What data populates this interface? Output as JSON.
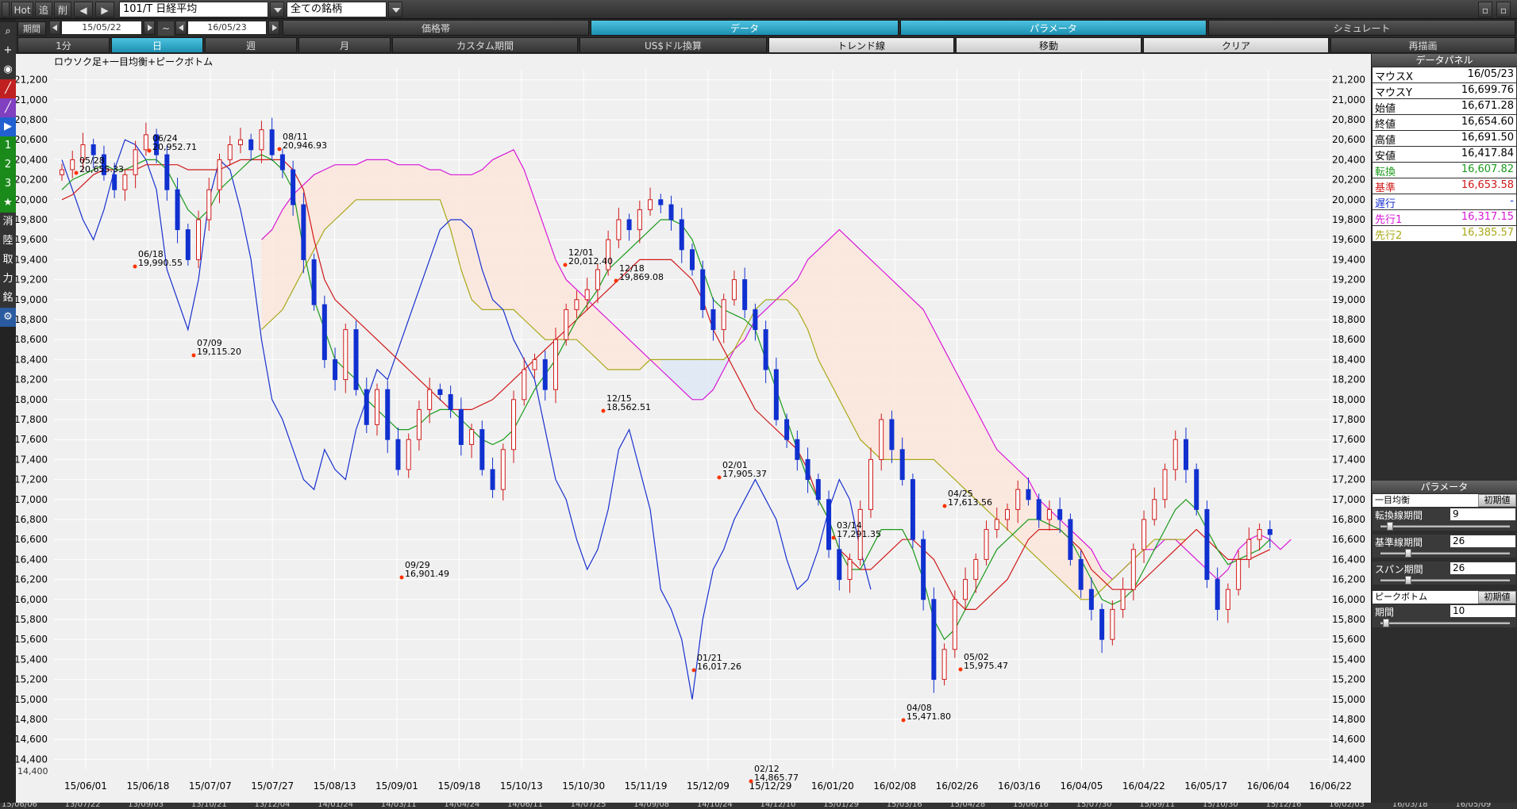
{
  "toolbar": {
    "hot": "Hot",
    "add": "追",
    "del": "削",
    "symbol": "101/T 日経平均",
    "filter": "全ての銘柄"
  },
  "period": {
    "label": "期間",
    "from": "15/05/22",
    "sep": "~",
    "to": "16/05/23"
  },
  "tabs_top": [
    "価格帯",
    "データ",
    "パラメータ",
    "シミュレート"
  ],
  "tabs_row3": [
    "1分",
    "日",
    "週",
    "月",
    "カスタム期間",
    "US$ドル換算",
    "トレンド線",
    "移動",
    "クリア",
    "再描画"
  ],
  "left_icons": [
    "⌕",
    "+",
    "◉",
    "╱",
    "╱",
    "▶",
    "1",
    "2",
    "3",
    "★",
    "消",
    "陸",
    "取",
    "力",
    "銘",
    "⚙"
  ],
  "chart": {
    "title": "ロウソク足+一目均衡+ピークボトム",
    "yticks": [
      "21,200",
      "21,000",
      "20,800",
      "20,600",
      "20,400",
      "20,200",
      "20,000",
      "19,800",
      "19,600",
      "19,400",
      "19,200",
      "19,000",
      "18,800",
      "18,600",
      "18,400",
      "18,200",
      "18,000",
      "17,800",
      "17,600",
      "17,400",
      "17,200",
      "17,000",
      "16,800",
      "16,600",
      "16,400",
      "16,200",
      "16,000",
      "15,800",
      "15,600",
      "15,400",
      "15,200",
      "15,000",
      "14,800",
      "14,600",
      "14,400"
    ],
    "xticks": [
      "15/06/01",
      "15/06/18",
      "15/07/07",
      "15/07/27",
      "15/08/13",
      "15/09/01",
      "15/09/18",
      "15/10/13",
      "15/10/30",
      "15/11/19",
      "15/12/09",
      "15/12/29",
      "16/01/20",
      "16/02/08",
      "16/02/26",
      "16/03/16",
      "16/04/05",
      "16/04/22",
      "16/05/17",
      "16/06/04",
      "16/06/22"
    ],
    "peaks": [
      {
        "date": "05/28",
        "value": "20,655.33"
      },
      {
        "date": "06/24",
        "value": "20,952.71"
      },
      {
        "date": "06/18",
        "value": "19,990.55"
      },
      {
        "date": "07/09",
        "value": "19,115.20"
      },
      {
        "date": "08/11",
        "value": "20,946.93"
      },
      {
        "date": "09/29",
        "value": "16,901.49"
      },
      {
        "date": "12/01",
        "value": "20,012.40"
      },
      {
        "date": "12/18",
        "value": "19,869.08"
      },
      {
        "date": "12/15",
        "value": "18,562.51"
      },
      {
        "date": "02/01",
        "value": "17,905.37"
      },
      {
        "date": "01/21",
        "value": "16,017.26"
      },
      {
        "date": "02/12",
        "value": "14,865.77"
      },
      {
        "date": "03/14",
        "value": "17,291.35"
      },
      {
        "date": "04/08",
        "value": "15,471.80"
      },
      {
        "date": "04/25",
        "value": "17,613.56"
      },
      {
        "date": "05/02",
        "value": "15,975.47"
      }
    ],
    "mini": "14,400"
  },
  "chart_data": {
    "type": "candlestick",
    "title": "ロウソク足+一目均衡+ピークボトム",
    "ylim": [
      14300,
      21300
    ],
    "series": [
      {
        "name": "candle_close",
        "values": [
          20300,
          20400,
          20550,
          20450,
          20250,
          20100,
          20250,
          20500,
          20650,
          20450,
          20100,
          19700,
          19400,
          19800,
          20100,
          20400,
          20550,
          20600,
          20500,
          20700,
          20450,
          20300,
          19950,
          19400,
          18950,
          18400,
          18200,
          18700,
          18100,
          17750,
          18100,
          17600,
          17300,
          17600,
          17900,
          18100,
          18050,
          17900,
          17550,
          17700,
          17300,
          17100,
          17500,
          18000,
          18300,
          18400,
          18100,
          18600,
          18900,
          19000,
          19100,
          19300,
          19600,
          19800,
          19700,
          19900,
          20000,
          19950,
          19800,
          19500,
          19300,
          18900,
          18700,
          19000,
          19200,
          18900,
          18700,
          18300,
          17800,
          17600,
          17400,
          17200,
          17000,
          16500,
          16200,
          16400,
          16900,
          17400,
          17800,
          17500,
          17200,
          16600,
          16000,
          15200,
          15500,
          16000,
          16200,
          16400,
          16700,
          16800,
          16900,
          17100,
          17000,
          16800,
          16900,
          16800,
          16400,
          16100,
          15900,
          15600,
          15900,
          16100,
          16500,
          16800,
          17000,
          17300,
          17600,
          17300,
          16900,
          16200,
          15900,
          16100,
          16400,
          16600,
          16700,
          16650
        ]
      },
      {
        "name": "転換線",
        "values": [
          20100,
          20200,
          20250,
          20300,
          20350,
          20300,
          20300,
          20350,
          20400,
          20400,
          20300,
          20100,
          19900,
          19800,
          19900,
          20100,
          20200,
          20300,
          20400,
          20450,
          20400,
          20300,
          20100,
          19500,
          19000,
          18700,
          18400,
          18300,
          18200,
          18000,
          17900,
          17800,
          17700,
          17700,
          17750,
          17850,
          17900,
          17900,
          17800,
          17700,
          17600,
          17550,
          17600,
          17700,
          17900,
          18100,
          18250,
          18400,
          18600,
          18800,
          18950,
          19100,
          19300,
          19400,
          19500,
          19600,
          19700,
          19800,
          19800,
          19750,
          19600,
          19300,
          19000,
          18900,
          18850,
          18800,
          18700,
          18400,
          18100,
          17800,
          17500,
          17200,
          17000,
          16800,
          16500,
          16300,
          16300,
          16500,
          16700,
          16700,
          16700,
          16500,
          16200,
          15800,
          15600,
          15700,
          15900,
          16100,
          16300,
          16500,
          16600,
          16700,
          16800,
          16800,
          16750,
          16700,
          16600,
          16400,
          16200,
          16000,
          15950,
          16000,
          16100,
          16300,
          16500,
          16700,
          16900,
          17000,
          16900,
          16700,
          16500,
          16350,
          16400,
          16450,
          16500,
          16600
        ]
      },
      {
        "name": "基準線",
        "values": [
          20000,
          20050,
          20150,
          20250,
          20300,
          20300,
          20300,
          20300,
          20350,
          20350,
          20350,
          20350,
          20300,
          20300,
          20300,
          20300,
          20350,
          20400,
          20400,
          20400,
          20400,
          20400,
          20300,
          20100,
          19600,
          19200,
          19000,
          18900,
          18800,
          18700,
          18600,
          18500,
          18400,
          18300,
          18200,
          18100,
          18000,
          17900,
          17900,
          17900,
          17950,
          18000,
          18100,
          18200,
          18300,
          18400,
          18500,
          18600,
          18700,
          18800,
          18900,
          19000,
          19100,
          19200,
          19300,
          19400,
          19400,
          19400,
          19400,
          19300,
          19200,
          19000,
          18700,
          18500,
          18300,
          18100,
          17900,
          17800,
          17700,
          17600,
          17500,
          17300,
          17000,
          16800,
          16500,
          16400,
          16300,
          16300,
          16400,
          16500,
          16600,
          16600,
          16500,
          16400,
          16200,
          16000,
          15900,
          15900,
          16000,
          16100,
          16200,
          16400,
          16600,
          16700,
          16700,
          16700,
          16600,
          16500,
          16300,
          16200,
          16100,
          16100,
          16100,
          16200,
          16300,
          16400,
          16500,
          16600,
          16700,
          16600,
          16500,
          16400,
          16400,
          16400,
          16450,
          16500
        ]
      },
      {
        "name": "遅行",
        "values": [
          20400,
          20100,
          19800,
          19600,
          19900,
          20300,
          20600,
          20550,
          20400,
          20100,
          19300,
          19000,
          18700,
          19200,
          20000,
          20400,
          20300,
          19900,
          19400,
          18600,
          18000,
          17800,
          17500,
          17200,
          17100,
          17500,
          17300,
          17200,
          17700,
          18000,
          18300,
          18200,
          18500,
          18800,
          19100,
          19400,
          19700,
          19800,
          19800,
          19700,
          19300,
          19000,
          18900,
          18600,
          18400,
          18200,
          17700,
          17200,
          17000,
          16600,
          16300,
          16500,
          16900,
          17500,
          17700,
          17300,
          16900,
          16100,
          15900,
          15600,
          15000,
          15800,
          16300,
          16500,
          16800,
          17000,
          17200,
          17000,
          16800,
          16400,
          16100,
          16200,
          16500,
          16900,
          17200,
          17000,
          16500,
          16100
        ]
      },
      {
        "name": "先行1",
        "values": [
          19600,
          19700,
          19900,
          20050,
          20150,
          20250,
          20300,
          20350,
          20350,
          20350,
          20400,
          20400,
          20400,
          20350,
          20350,
          20350,
          20300,
          20300,
          20250,
          20250,
          20250,
          20300,
          20400,
          20450,
          20500,
          20300,
          20000,
          19700,
          19400,
          19200,
          19100,
          19000,
          18900,
          18800,
          18700,
          18600,
          18500,
          18400,
          18300,
          18200,
          18100,
          18000,
          18000,
          18100,
          18300,
          18500,
          18600,
          18800,
          18900,
          19000,
          19100,
          19200,
          19400,
          19500,
          19600,
          19700,
          19600,
          19500,
          19400,
          19300,
          19200,
          19100,
          19000,
          18900,
          18700,
          18500,
          18300,
          18100,
          17900,
          17700,
          17500,
          17400,
          17300,
          17200,
          17000,
          16900,
          16800,
          16700,
          16600,
          16500,
          16300,
          16200,
          16300,
          16400,
          16500,
          16500,
          16600,
          16600,
          16500,
          16400,
          16300,
          16200,
          16300,
          16500,
          16600,
          16650,
          16600,
          16500,
          16600
        ]
      },
      {
        "name": "先行2",
        "values": [
          18700,
          18800,
          18900,
          19100,
          19300,
          19500,
          19700,
          19800,
          19900,
          20000,
          20000,
          20000,
          20000,
          20000,
          20000,
          20000,
          20000,
          20000,
          19700,
          19300,
          19000,
          18900,
          18900,
          18900,
          18900,
          18800,
          18700,
          18600,
          18600,
          18600,
          18600,
          18500,
          18400,
          18300,
          18300,
          18300,
          18300,
          18400,
          18400,
          18400,
          18400,
          18400,
          18400,
          18400,
          18400,
          18500,
          18700,
          18900,
          19000,
          19000,
          19000,
          18900,
          18700,
          18400,
          18200,
          18000,
          17800,
          17600,
          17500,
          17400,
          17400,
          17400,
          17400,
          17400,
          17400,
          17300,
          17200,
          17100,
          17000,
          16900,
          16800,
          16700,
          16600,
          16500,
          16400,
          16300,
          16200,
          16100,
          16000,
          16000,
          16100,
          16200,
          16300,
          16400,
          16500,
          16600,
          16600,
          16600,
          16600
        ]
      }
    ]
  },
  "dpanel": {
    "title": "データパネル",
    "rows": [
      {
        "k": "マウスX",
        "v": "16/05/23",
        "c": "#000000"
      },
      {
        "k": "マウスY",
        "v": "16,699.76",
        "c": "#000000"
      },
      {
        "k": "始値",
        "v": "16,671.28",
        "c": "#000000"
      },
      {
        "k": "終値",
        "v": "16,654.60",
        "c": "#000000"
      },
      {
        "k": "高値",
        "v": "16,691.50",
        "c": "#000000"
      },
      {
        "k": "安値",
        "v": "16,417.84",
        "c": "#000000"
      },
      {
        "k": "転換",
        "v": "16,607.82",
        "c": "#1a9a1a"
      },
      {
        "k": "基準",
        "v": "16,653.58",
        "c": "#d01818"
      },
      {
        "k": "遅行",
        "v": "-",
        "c": "#1830d0"
      },
      {
        "k": "先行1",
        "v": "16,317.15",
        "c": "#d818d8"
      },
      {
        "k": "先行2",
        "v": "16,385.57",
        "c": "#a8a818"
      }
    ],
    "param_title": "パラメータ",
    "ichi": {
      "title": "一目均衡",
      "reset": "初期値"
    },
    "params": [
      {
        "label": "転換線期間",
        "value": "9",
        "pos": 0.05
      },
      {
        "label": "基準線期間",
        "value": "26",
        "pos": 0.2
      },
      {
        "label": "スパン期間",
        "value": "26",
        "pos": 0.2
      }
    ],
    "peak": {
      "title": "ピークボトム",
      "reset": "初期値",
      "label": "期間",
      "value": "10",
      "pos": 0.02
    }
  },
  "bottom_ticks": [
    "15/06/06",
    "13/07/22",
    "13/09/03",
    "13/10/21",
    "13/12/04",
    "14/01/24",
    "14/03/11",
    "14/04/24",
    "14/06/11",
    "14/07/25",
    "14/09/08",
    "14/10/24",
    "14/12/10",
    "15/01/29",
    "15/03/16",
    "15/04/28",
    "15/06/16",
    "15/07/30",
    "15/09/11",
    "15/10/30",
    "15/12/16",
    "16/02/03",
    "16/03/18",
    "16/05/09"
  ]
}
